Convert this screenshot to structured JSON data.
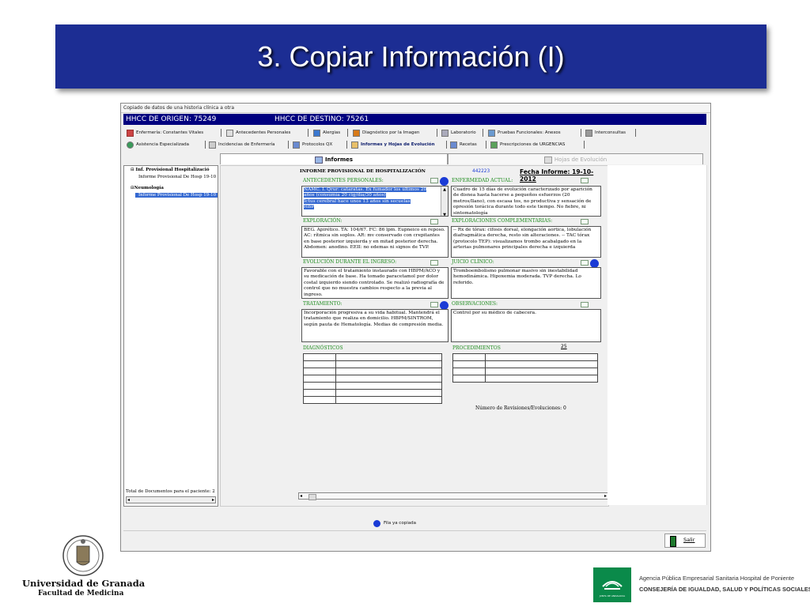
{
  "slide": {
    "title": "3.  Copiar Información (I)"
  },
  "window": {
    "title": "Copiado de datos de una historia clínica a otra",
    "origin": "HHCC DE ORIGEN:  75249",
    "destination": "HHCC DE DESTINO:  75261"
  },
  "toolbar_row1": [
    {
      "label": "Enfermería: Constantes Vitales",
      "icon": "pencil-icon"
    },
    {
      "label": "Antecedentes Personales",
      "icon": "people-icon"
    },
    {
      "label": "Alergias",
      "icon": "alert-icon"
    },
    {
      "label": "Diagnóstico por la Imagen",
      "icon": "image-icon"
    },
    {
      "label": "Laboratorio",
      "icon": "flask-icon"
    },
    {
      "label": "Pruebas Funcionales: Anexos",
      "icon": "chart-icon"
    },
    {
      "label": "Interconsultas",
      "icon": "doc-icon"
    }
  ],
  "toolbar_row2": [
    {
      "label": "Asistencia Especializada",
      "icon": "search-icon"
    },
    {
      "label": "Incidencias de Enfermería",
      "icon": "nurse-icon"
    },
    {
      "label": "Protocolos QX",
      "icon": "clipboard-icon"
    },
    {
      "label": "Informes y Hojas de Evolución",
      "icon": "report-icon",
      "active": true
    },
    {
      "label": "Recetas",
      "icon": "prescription-icon"
    },
    {
      "label": "Prescripciones de URGENCIAS",
      "icon": "emergency-icon"
    }
  ],
  "tabs": {
    "informes": "Informes",
    "hojas": "Hojas de Evolución"
  },
  "tree": {
    "group1": "Inf. Provisional Hospitalizació",
    "item1": "Informe Provisional De Hosp  19-10",
    "group2": "Neumología",
    "item2": "Informe Provisional De Hosp  19-10",
    "total": "Total de Documentos para el paciente: 2"
  },
  "report": {
    "heading": "INFORME PROVISIONAL DE HOSPITALIZACIÓN",
    "number": "442223",
    "date_label": "Fecha Informe: 19-10-2012",
    "antecedentes_label": "ANTECEDENTES PERSONALES:",
    "antecedentes_lines": [
      "NAMC. I. Qrur: cataratas. Ex fumador los últimos 20",
      "años (consumía 20 cig/día/30 años)",
      "Ictus cerebral hace unos 13 años sin secuelas",
      "HBP"
    ],
    "enfermedad_label": "ENFERMEDAD ACTUAL:",
    "enfermedad_text": "Cuadro de 15 días de evolución caracterizado por aparición de disnea hasta hacerse a pequeños esfuerzos (20 metros/llano), con escasa tos, no productiva y sensación de opresión torácica durante todo este tiempo. No fiebre, ni sintomatología",
    "exploracion_label": "EXPLORACIÓN:",
    "exploracion_text": "BEG. Apirético. TA: 104/67. FC: 86 lpm. Eupneico en reposo. AC: rítmica sin soplos. AR: mv conservado con crepitantes en base posterior izquierda y en mitad posterior derecha. Abdomen: anodino. EEII: no edemas ni signos de TVP.",
    "exploraciones_label": "EXPLORACIONES COMPLEMENTARIAS:",
    "exploraciones_text": "-- Rx de tórax: cifosis dorsal, elongación aortica, lobulación diafragmática derecha, resto sin alteraciones. -- TAC tórax (protocolo TEP): visualizamos trombo acabalgado en la arterias pulmonares principales derecha e izquierda",
    "evolucion_label": "EVOLUCIÓN DURANTE EL INGRESO:",
    "evolucion_text": "Favorable con el tratamiento instaurado con HBPM/ACO y su medicación de base. Ha tomado paracetamol por dolor costal izquierdo siendo controlado. Se realizó radiografía de control que no muestra cambios respecto a la previa al ingreso.",
    "juicio_label": "JUICIO CLÍNICO:",
    "juicio_text": "Tromboembolismo pulmonar masivo sin inestabilidad hemodinámica. Hipoxemia moderada. TVP derecha. Lo referido.",
    "tratamiento_label": "TRATAMIENTO:",
    "tratamiento_text": "Incorporación progresiva a su vida habitual. Mantendrá el tratamiento que realiza en domicilio. HBPM/SINTROM, según pauta de Hematología. Medias de compresión media.",
    "observaciones_label": "OBSERVACIONES:",
    "observaciones_text": "Control por su médico de cabecera.",
    "diagnosticos_label": "DIAGNÓSTICOS",
    "procedimientos_label": "PROCEDIMIENTOS",
    "procedimientos_mark": "25",
    "revisiones": "Número de Revisiones/Evoluciones: 0"
  },
  "status": {
    "copied": "Fila ya copiada"
  },
  "footer": {
    "exit_label": "Salir"
  },
  "logos": {
    "university_line1": "Universidad de Granada",
    "university_line2": "Facultad de Medicina",
    "agency_line1": "Agencia Pública Empresarial Sanitaria Hospital de Poniente",
    "agency_line2": "CONSEJERÍA DE IGUALDAD, SALUD Y POLÍTICAS SOCIALES",
    "junta_small": "JUNTA DE ANDALUCIA"
  },
  "colors": {
    "banner": "#1c2d93",
    "hhcc_bar": "#00007f",
    "section_label": "#1a8a1a",
    "selection": "#3468d1",
    "status_dot": "#1a3bd6",
    "junta_green": "#0a8a4a"
  }
}
